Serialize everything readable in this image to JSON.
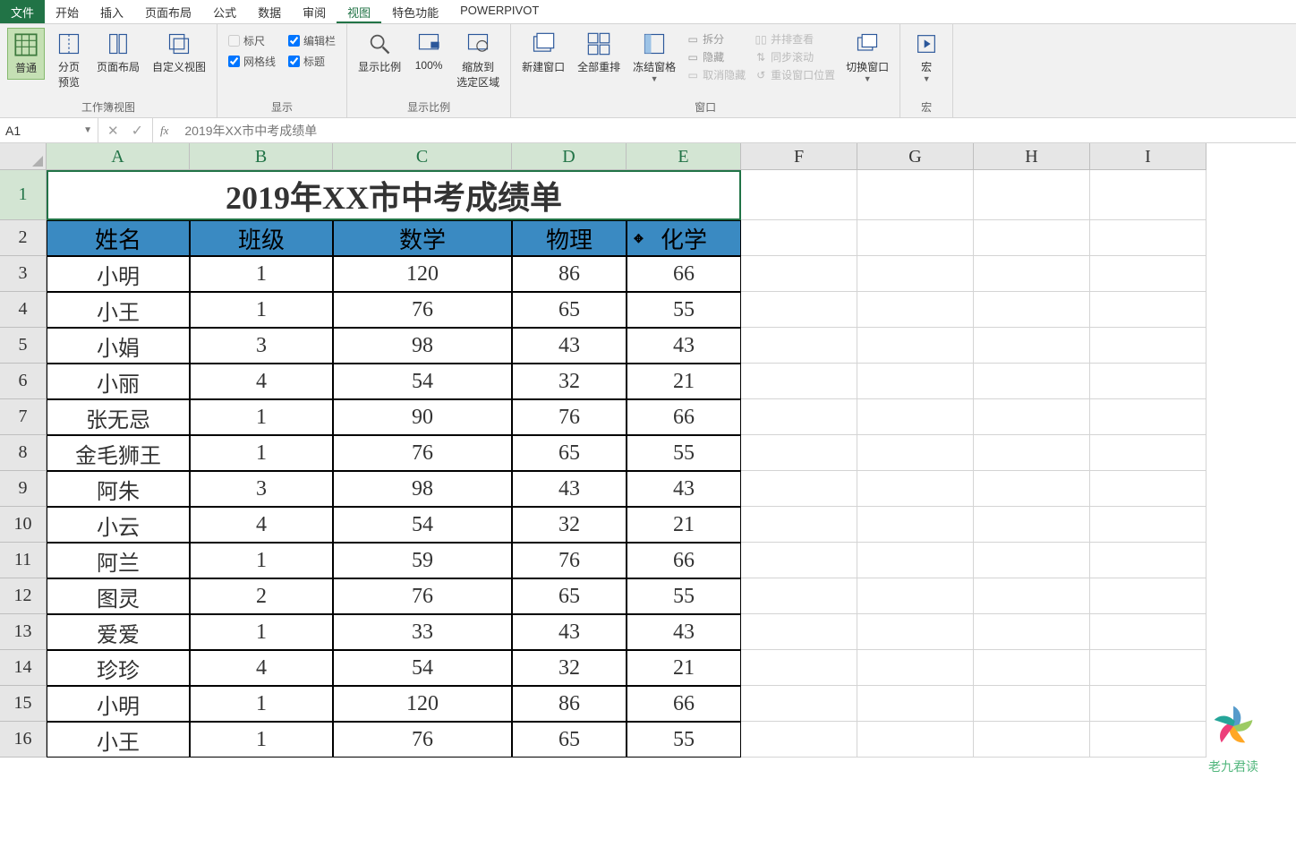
{
  "menu": {
    "file": "文件",
    "items": [
      "开始",
      "插入",
      "页面布局",
      "公式",
      "数据",
      "审阅",
      "视图",
      "特色功能",
      "POWERPIVOT"
    ],
    "active_index": 6
  },
  "ribbon": {
    "group_workbook_views": {
      "label": "工作簿视图",
      "normal": "普通",
      "page_break": "分页\n预览",
      "page_layout": "页面布局",
      "custom_views": "自定义视图"
    },
    "group_show": {
      "label": "显示",
      "ruler": "标尺",
      "formula_bar": "编辑栏",
      "gridlines": "网格线",
      "headings": "标题"
    },
    "group_zoom": {
      "label": "显示比例",
      "zoom": "显示比例",
      "hundred": "100%",
      "zoom_selection": "缩放到\n选定区域"
    },
    "group_window": {
      "label": "窗口",
      "new_window": "新建窗口",
      "arrange_all": "全部重排",
      "freeze_panes": "冻结窗格",
      "split": "拆分",
      "hide": "隐藏",
      "unhide": "取消隐藏",
      "view_side": "并排查看",
      "sync_scroll": "同步滚动",
      "reset_pos": "重设窗口位置",
      "switch_windows": "切换窗口"
    },
    "group_macros": {
      "label": "宏",
      "macros": "宏"
    }
  },
  "namebox": "A1",
  "formula": "2019年XX市中考成绩单",
  "columns": [
    "A",
    "B",
    "C",
    "D",
    "E",
    "F",
    "G",
    "H",
    "I"
  ],
  "title": "2019年XX市中考成绩单",
  "headers": [
    "姓名",
    "班级",
    "数学",
    "物理",
    "化学"
  ],
  "rows": [
    {
      "n": "3",
      "name": "小明",
      "class": "1",
      "math": "120",
      "phys": "86",
      "chem": "66"
    },
    {
      "n": "4",
      "name": "小王",
      "class": "1",
      "math": "76",
      "phys": "65",
      "chem": "55"
    },
    {
      "n": "5",
      "name": "小娟",
      "class": "3",
      "math": "98",
      "phys": "43",
      "chem": "43"
    },
    {
      "n": "6",
      "name": "小丽",
      "class": "4",
      "math": "54",
      "phys": "32",
      "chem": "21"
    },
    {
      "n": "7",
      "name": "张无忌",
      "class": "1",
      "math": "90",
      "phys": "76",
      "chem": "66"
    },
    {
      "n": "8",
      "name": "金毛狮王",
      "class": "1",
      "math": "76",
      "phys": "65",
      "chem": "55"
    },
    {
      "n": "9",
      "name": "阿朱",
      "class": "3",
      "math": "98",
      "phys": "43",
      "chem": "43"
    },
    {
      "n": "10",
      "name": "小云",
      "class": "4",
      "math": "54",
      "phys": "32",
      "chem": "21"
    },
    {
      "n": "11",
      "name": "阿兰",
      "class": "1",
      "math": "59",
      "phys": "76",
      "chem": "66"
    },
    {
      "n": "12",
      "name": "图灵",
      "class": "2",
      "math": "76",
      "phys": "65",
      "chem": "55"
    },
    {
      "n": "13",
      "name": "爱爱",
      "class": "1",
      "math": "33",
      "phys": "43",
      "chem": "43"
    },
    {
      "n": "14",
      "name": "珍珍",
      "class": "4",
      "math": "54",
      "phys": "32",
      "chem": "21"
    },
    {
      "n": "15",
      "name": "小明",
      "class": "1",
      "math": "120",
      "phys": "86",
      "chem": "66"
    },
    {
      "n": "16",
      "name": "小王",
      "class": "1",
      "math": "76",
      "phys": "65",
      "chem": "55"
    }
  ],
  "watermark": "老九君读"
}
